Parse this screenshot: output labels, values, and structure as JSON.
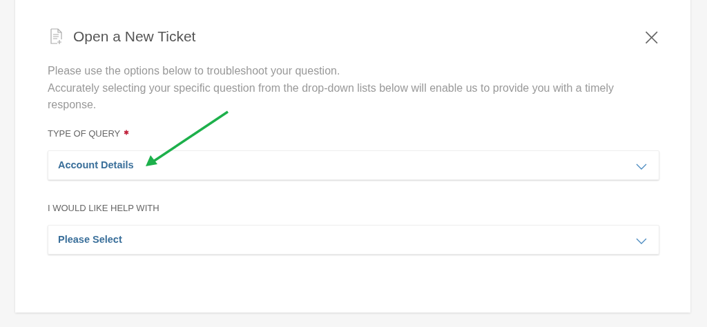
{
  "dialog": {
    "title": "Open a New Ticket",
    "close": "×",
    "intro": [
      "Please use the options below to troubleshoot your question.",
      "Accurately selecting your specific question from the drop-down lists below will enable us to provide you with a timely response."
    ],
    "fields": [
      {
        "label": "TYPE OF QUERY",
        "required": true,
        "value": "Account Details"
      },
      {
        "label": "I WOULD LIKE HELP WITH",
        "required": false,
        "value": "Please Select"
      }
    ]
  }
}
